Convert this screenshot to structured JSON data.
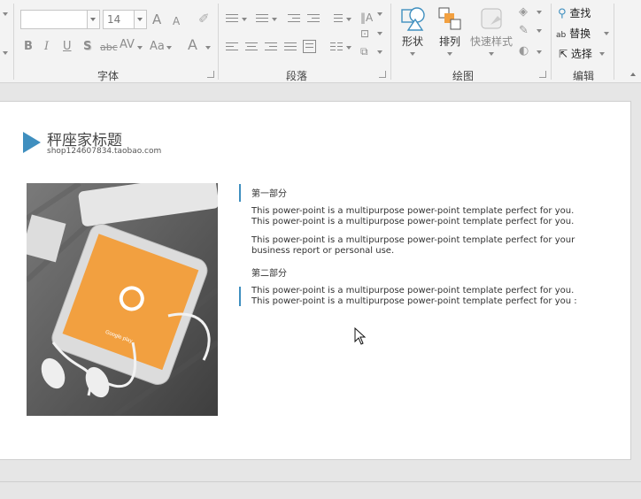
{
  "ribbon": {
    "font_group": {
      "label": "字体",
      "font_name": "",
      "font_size": "14",
      "bold": "B",
      "italic": "I",
      "underline": "U",
      "shadow": "S",
      "strike": "abc",
      "spacing": "AV",
      "case": "Aa",
      "grow": "A",
      "shrink": "A",
      "color_a": "A"
    },
    "paragraph_group": {
      "label": "段落"
    },
    "drawing_group": {
      "label": "绘图",
      "shapes_label": "形状",
      "arrange_label": "排列",
      "quick_styles_label": "快速样式"
    },
    "editing_group": {
      "label": "编辑",
      "find_label": "查找",
      "replace_label": "替换",
      "select_label": "选择",
      "replace_icon_text": "ab"
    }
  },
  "slide": {
    "title": "秤座家标题",
    "subtitle": "shop124607834.taobao.com",
    "photo_caption": "Google play",
    "section1_heading": "第一部分",
    "para1_line1": "This power-point is a multipurpose power-point template perfect for you.",
    "para1_line2": "This power-point is a multipurpose power-point template perfect for you.",
    "para2": "This power-point is a multipurpose power-point template perfect for your business report or personal use.",
    "section2_heading": "第二部分",
    "para3_line1": "This power-point is a multipurpose power-point template perfect for you.",
    "para3_line2": "This power-point is a multipurpose power-point template perfect for you :"
  },
  "colors": {
    "accent": "#3f8fbf",
    "orange": "#f2a040"
  }
}
